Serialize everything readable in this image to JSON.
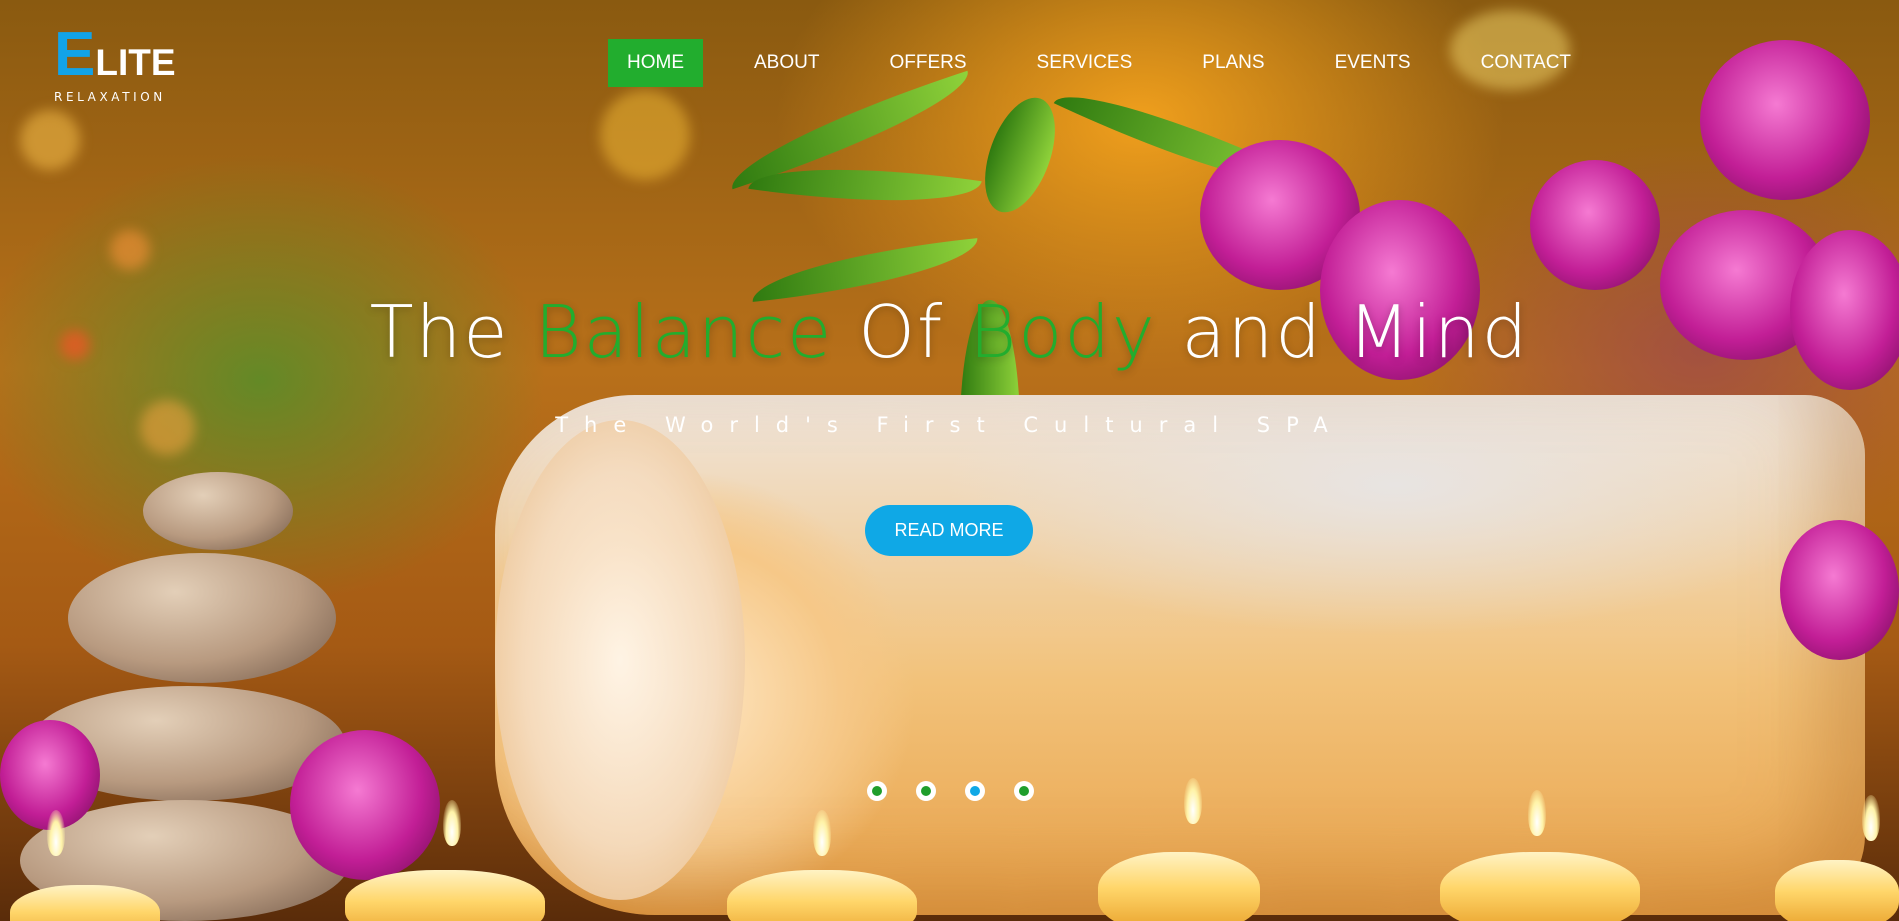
{
  "logo": {
    "initial": "E",
    "rest": "LITE",
    "tagline": "RELAXATION"
  },
  "nav": {
    "items": [
      {
        "label": "HOME",
        "active": true
      },
      {
        "label": "ABOUT"
      },
      {
        "label": "OFFERS"
      },
      {
        "label": "SERVICES"
      },
      {
        "label": "PLANS"
      },
      {
        "label": "EVENTS"
      },
      {
        "label": "CONTACT"
      }
    ]
  },
  "hero": {
    "title_part1": "The ",
    "title_green1": "Balance",
    "title_part2": " Of ",
    "title_green2": "Body",
    "title_part3": " and Mind",
    "subtitle": "The World's First Cultural SPA",
    "button_label": "READ MORE"
  },
  "slider": {
    "dot_count": 4,
    "active_index": 2
  },
  "colors": {
    "accent_green": "#22ad2e",
    "accent_blue": "#0fa8e6"
  }
}
